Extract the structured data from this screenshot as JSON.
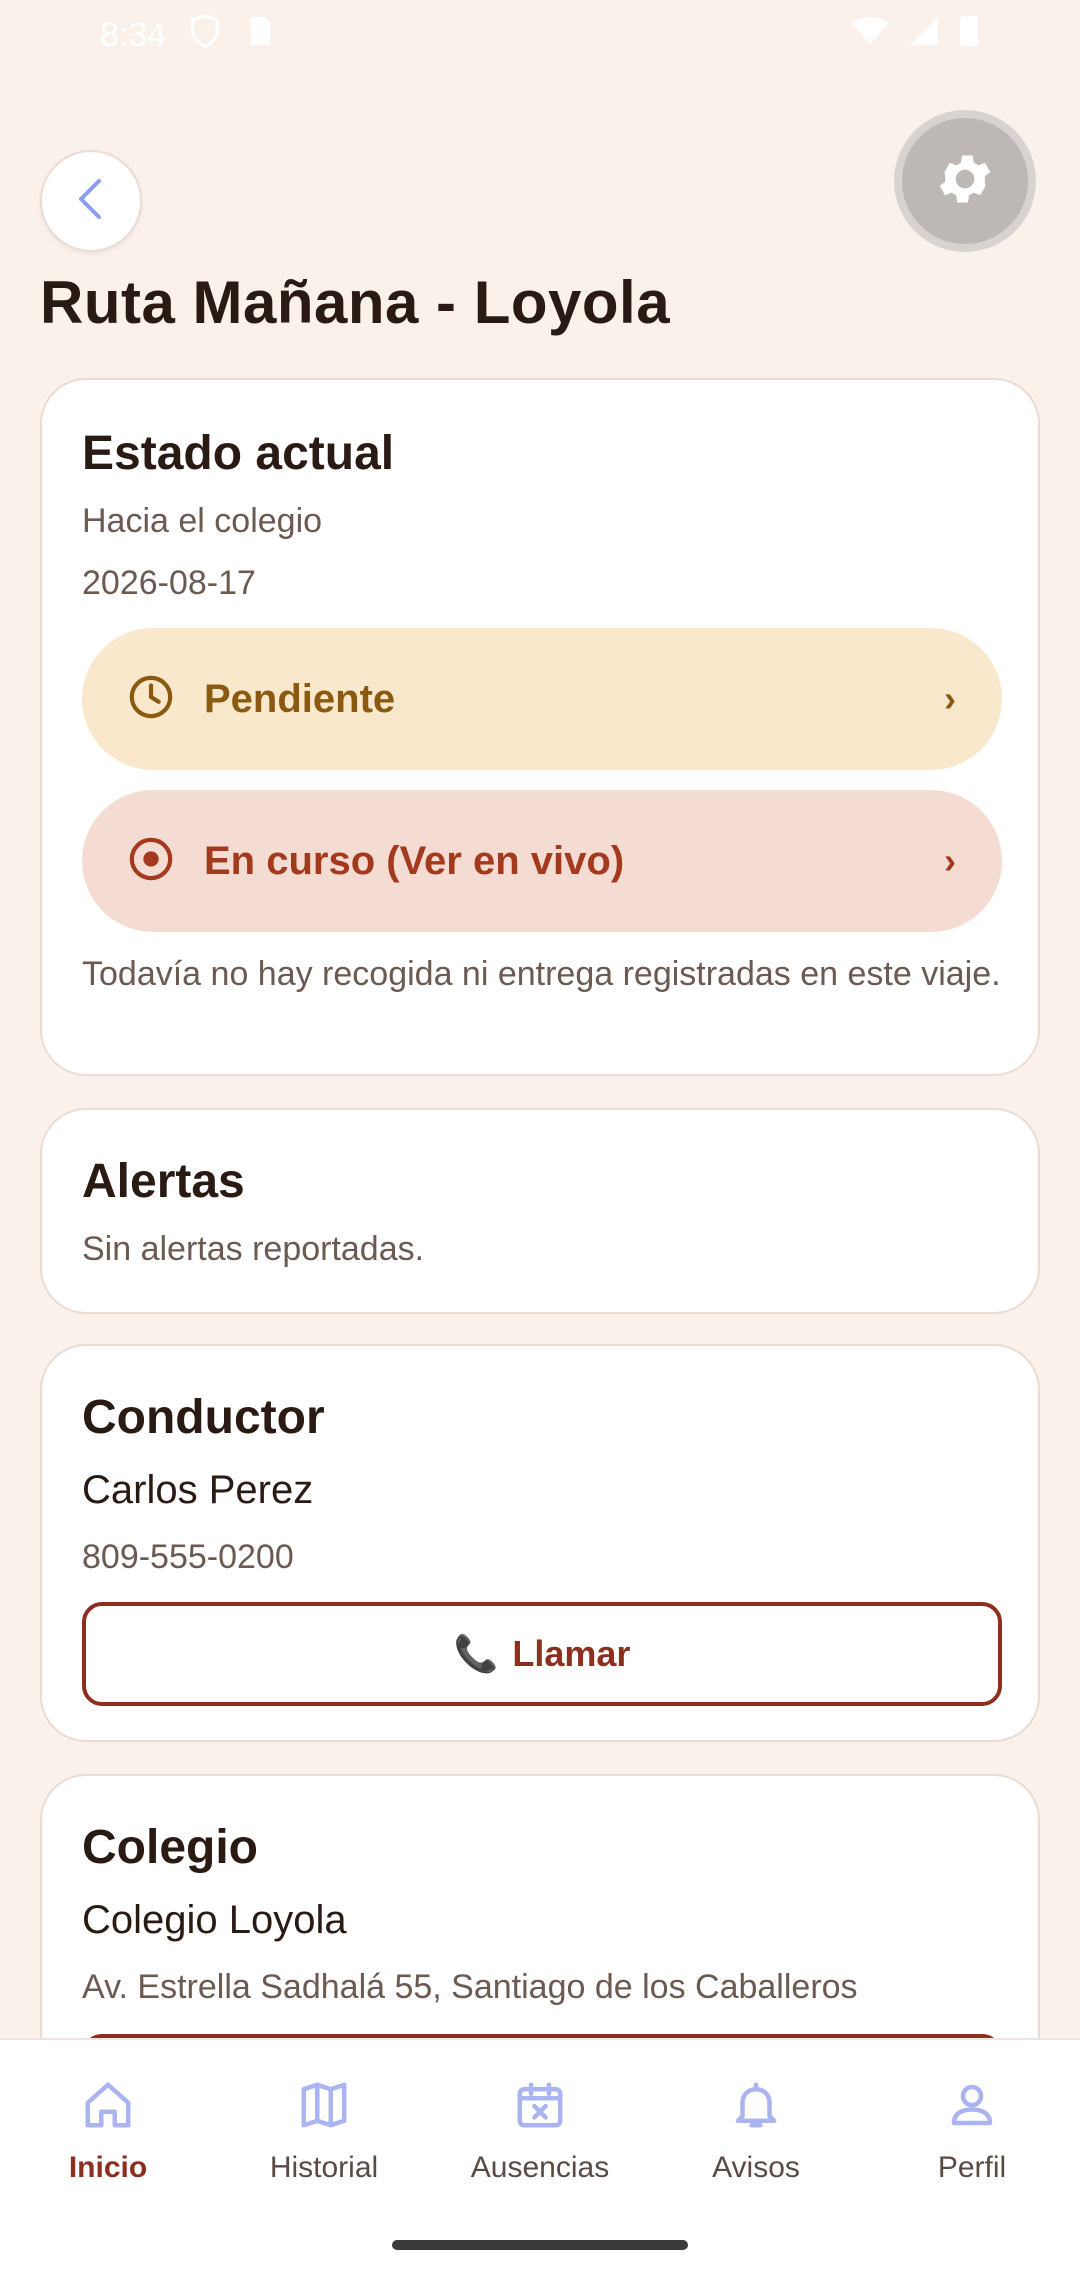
{
  "status_bar": {
    "time": "8:34"
  },
  "header": {
    "title": "Ruta Mañana - Loyola"
  },
  "estado": {
    "title": "Estado actual",
    "direction": "Hacia el colegio",
    "date": "2026-08-17",
    "pending_label": "Pendiente",
    "in_progress_label": "En curso (Ver en vivo)",
    "chevron": "›",
    "note": "Todavía no hay recogida ni entrega registradas en este viaje."
  },
  "alertas": {
    "title": "Alertas",
    "text": "Sin alertas reportadas."
  },
  "conductor": {
    "title": "Conductor",
    "name": "Carlos Perez",
    "phone": "809-555-0200",
    "call_label": "Llamar",
    "call_icon": "📞"
  },
  "colegio": {
    "title": "Colegio",
    "name": "Colegio Loyola",
    "address": "Av. Estrella Sadhalá 55, Santiago de los Caballeros"
  },
  "nav": {
    "items": [
      {
        "label": "Inicio",
        "icon": "home-icon"
      },
      {
        "label": "Historial",
        "icon": "map-icon"
      },
      {
        "label": "Ausencias",
        "icon": "calendar-x-icon"
      },
      {
        "label": "Avisos",
        "icon": "bell-icon"
      },
      {
        "label": "Perfil",
        "icon": "person-icon"
      }
    ]
  },
  "colors": {
    "accent": "#8E2E1E",
    "pending_bg": "#FAE8CC",
    "pending_fg": "#8A5A10",
    "in_progress_bg": "#F4DCD2",
    "in_progress_fg": "#A33A1E",
    "nav_icon": "#A9B4F0"
  }
}
